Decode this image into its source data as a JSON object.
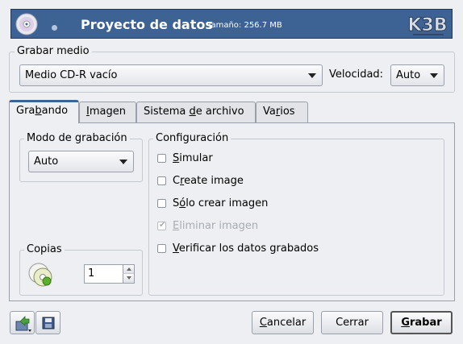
{
  "header": {
    "title": "Proyecto de datos",
    "size_text": "Tamaño: 256.7 MB",
    "logo_text": "K3B",
    "accent": "#3d6294"
  },
  "burn_medium": {
    "label": "Grabar medio",
    "medium_value": "Medio CD-R vacío",
    "speed_label": "Velocidad:",
    "speed_value": "Auto"
  },
  "tabs": [
    {
      "pre": "Gra",
      "key": "b",
      "post": "ando",
      "active": true
    },
    {
      "pre": "",
      "key": "I",
      "post": "magen",
      "active": false
    },
    {
      "pre": "Sistema ",
      "key": "d",
      "post": "e archivo",
      "active": false
    },
    {
      "pre": "Va",
      "key": "r",
      "post": "ios",
      "active": false
    }
  ],
  "write_mode": {
    "label": "Modo de grabación",
    "value": "Auto"
  },
  "copies": {
    "label": "Copias",
    "value": "1",
    "icon": "cd-copy-icon"
  },
  "configuration": {
    "label": "Configuración",
    "options": [
      {
        "pre": "",
        "key": "S",
        "post": "imular",
        "checked": false,
        "enabled": true
      },
      {
        "pre": "C",
        "key": "r",
        "post": "eate image",
        "checked": false,
        "enabled": true
      },
      {
        "pre": "S",
        "key": "ó",
        "post": "lo crear imagen",
        "checked": false,
        "enabled": true
      },
      {
        "pre": "",
        "key": "E",
        "post": "liminar imagen",
        "checked": true,
        "enabled": false
      },
      {
        "pre": "",
        "key": "V",
        "post": "erificar los datos grabados",
        "checked": false,
        "enabled": true
      }
    ]
  },
  "footer": {
    "load_icon": "load-settings-icon",
    "save_icon": "save-icon",
    "cancel": {
      "pre": "",
      "key": "C",
      "post": "ancelar"
    },
    "close": "Cerrar",
    "burn": {
      "pre": "",
      "key": "G",
      "post": "rabar"
    }
  }
}
